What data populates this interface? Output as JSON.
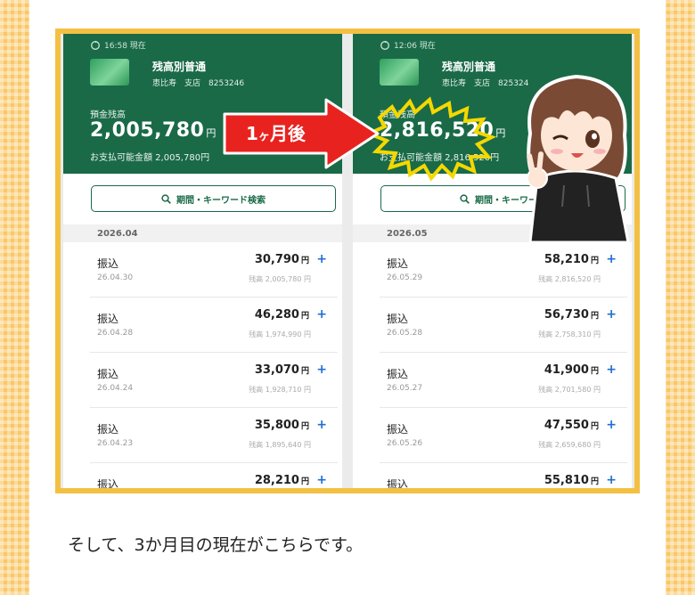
{
  "left_phone": {
    "time": "16:58 現在",
    "account_type": "残高別普通",
    "branch": "恵比寿　支店",
    "account_no": "8253246",
    "balance_label": "預金残高",
    "balance": "2,005,780",
    "yen": "円",
    "available": "お支払可能金額 2,005,780円",
    "search_label": "期間・キーワード検索",
    "month": "2026.04",
    "transactions": [
      {
        "type": "振込",
        "date": "26.04.30",
        "amount": "30,790",
        "after": "残高 2,005,780 円"
      },
      {
        "type": "振込",
        "date": "26.04.28",
        "amount": "46,280",
        "after": "残高 1,974,990 円"
      },
      {
        "type": "振込",
        "date": "26.04.24",
        "amount": "33,070",
        "after": "残高 1,928,710 円"
      },
      {
        "type": "振込",
        "date": "26.04.23",
        "amount": "35,800",
        "after": "残高 1,895,640 円"
      },
      {
        "type": "振込",
        "date": "",
        "amount": "28,210",
        "after": ""
      }
    ]
  },
  "right_phone": {
    "time": "12:06 現在",
    "account_type": "残高別普通",
    "branch": "恵比寿　支店",
    "account_no": "825324",
    "balance_label": "預金残高",
    "balance": "2,816,520",
    "yen": "円",
    "available": "お支払可能金額 2,816,520円",
    "search_label": "期間・キーワード",
    "month": "2026.05",
    "transactions": [
      {
        "type": "振込",
        "date": "26.05.29",
        "amount": "58,210",
        "after": "残高 2,816,520 円"
      },
      {
        "type": "振込",
        "date": "26.05.28",
        "amount": "56,730",
        "after": "残高 2,758,310 円"
      },
      {
        "type": "振込",
        "date": "26.05.27",
        "amount": "41,900",
        "after": "残高 2,701,580 円"
      },
      {
        "type": "振込",
        "date": "26.05.26",
        "amount": "47,550",
        "after": "残高 2,659,680 円"
      },
      {
        "type": "振込",
        "date": "",
        "amount": "55,810",
        "after": ""
      }
    ]
  },
  "arrow": {
    "number": "1",
    "small": "ヶ",
    "rest": "月後"
  },
  "plus_symbol": "+",
  "caption": "そして、3か月目の現在がこちらです。",
  "colors": {
    "header_green": "#1a6a48",
    "arrow_red": "#e8231f",
    "frame_yellow": "#f3c042",
    "plus_blue": "#1f6fd4"
  }
}
